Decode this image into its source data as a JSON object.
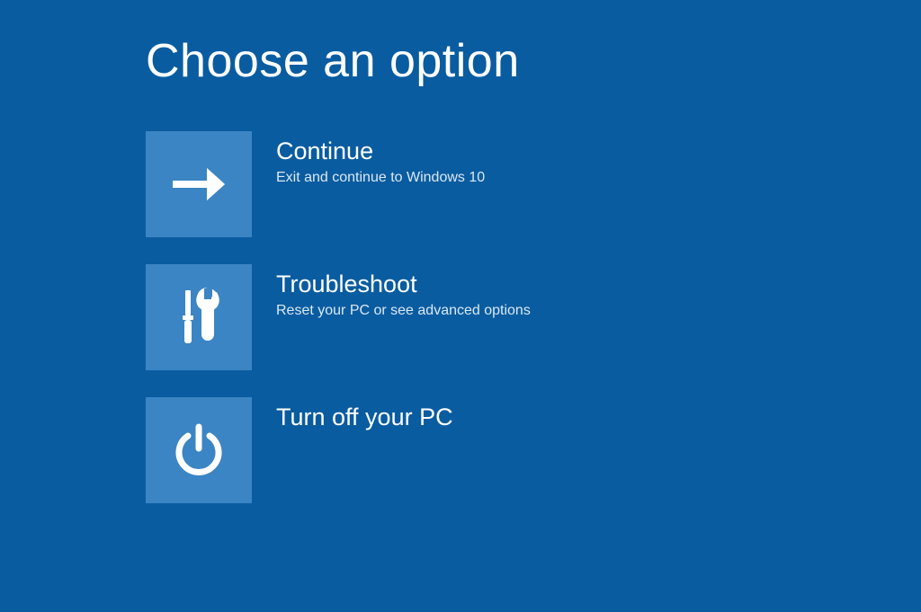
{
  "page": {
    "title": "Choose an option"
  },
  "options": [
    {
      "title": "Continue",
      "description": "Exit and continue to Windows 10"
    },
    {
      "title": "Troubleshoot",
      "description": "Reset your PC or see advanced options"
    },
    {
      "title": "Turn off your PC",
      "description": ""
    }
  ],
  "colors": {
    "background": "#0a5ca0",
    "tile": "#3b85c4",
    "text": "#ffffff"
  }
}
